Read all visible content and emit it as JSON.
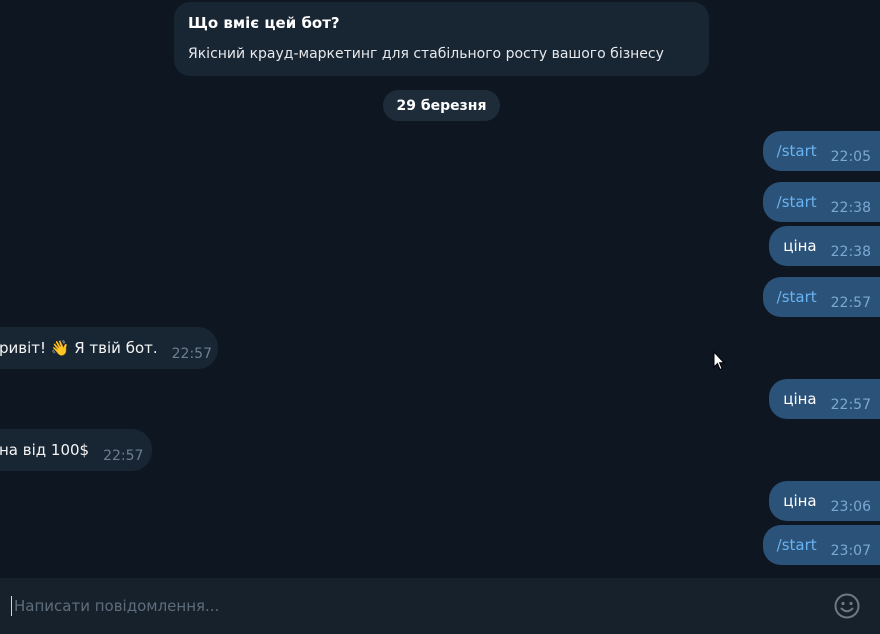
{
  "bot_info": {
    "title": "Що вміє цей бот?",
    "description": "Якісний крауд-маркетинг для стабільного росту вашого бізнесу"
  },
  "date_separator": "29 березня",
  "messages": [
    {
      "direction": "out",
      "text": "/start",
      "time": "22:05",
      "is_command": true
    },
    {
      "direction": "out",
      "text": "/start",
      "time": "22:38",
      "is_command": true
    },
    {
      "direction": "out",
      "text": "ціна",
      "time": "22:38",
      "is_command": false
    },
    {
      "direction": "out",
      "text": "/start",
      "time": "22:57",
      "is_command": true
    },
    {
      "direction": "in",
      "text": "ривіт! 👋 Я твій бот.",
      "time": "22:57"
    },
    {
      "direction": "out",
      "text": "ціна",
      "time": "22:57",
      "is_command": false
    },
    {
      "direction": "in",
      "text": "на від 100$",
      "time": "22:57"
    },
    {
      "direction": "out",
      "text": "ціна",
      "time": "23:06",
      "is_command": false
    },
    {
      "direction": "out",
      "text": "/start",
      "time": "23:07",
      "is_command": true
    }
  ],
  "composer": {
    "placeholder": "Написати повідомлення...",
    "value": "",
    "emoji_icon": "smiley-icon"
  },
  "colors": {
    "background": "#0e1621",
    "outgoing_bubble": "#2b5278",
    "incoming_bubble": "#182533",
    "command_link": "#6ab3f3",
    "composer_bg": "#17212b"
  }
}
